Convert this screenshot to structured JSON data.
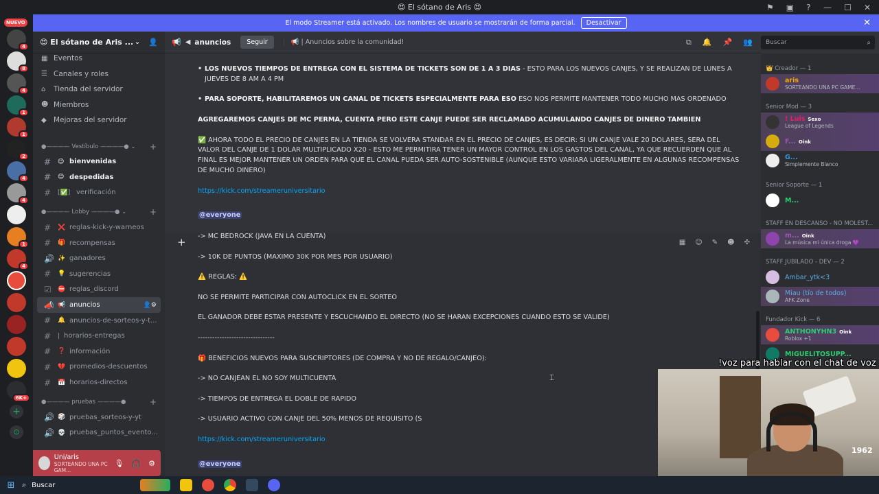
{
  "titlebar": {
    "title": "😍 El sótano de Aris 😍"
  },
  "banner": {
    "text": "El modo Streamer está activado. Los nombres de usuario se mostrarán de forma parcial.",
    "button": "Desactivar"
  },
  "rail": {
    "new_badge": "NUEVO",
    "pings": [
      "4",
      "8",
      "4",
      "1",
      "1",
      "2",
      "4",
      "4",
      "1",
      "4",
      "6K+"
    ]
  },
  "server": {
    "name": "😍 El sótano de Aris ..."
  },
  "menu": [
    "Eventos",
    "Canales y roles",
    "Tienda del servidor",
    "Miembros",
    "Mejoras del servidor"
  ],
  "categories": {
    "vestibulo": "Vestíbulo",
    "lobby": "Lobby",
    "pruebas": "pruebas"
  },
  "channels_vestibulo": [
    {
      "emoji": "😊",
      "name": "bienvenidas"
    },
    {
      "emoji": "😊",
      "name": "despedidas"
    },
    {
      "emoji": "[✅]",
      "name": "verificación"
    }
  ],
  "channels_lobby": [
    {
      "emoji": "❌",
      "name": "reglas-kick-y-warneos"
    },
    {
      "emoji": "🎁",
      "name": "recompensas"
    },
    {
      "emoji": "✨",
      "name": "ganadores"
    },
    {
      "emoji": "💡",
      "name": "sugerencias"
    },
    {
      "emoji": "⛔",
      "name": "reglas_discord"
    },
    {
      "emoji": "📢",
      "name": "anuncios"
    },
    {
      "emoji": "🔔",
      "name": "anuncios-de-sorteos-y-t..."
    },
    {
      "emoji": "",
      "name": "horarios-entregas"
    },
    {
      "emoji": "❓",
      "name": "información"
    },
    {
      "emoji": "💔",
      "name": "promedios-descuentos"
    },
    {
      "emoji": "📅",
      "name": "horarios-directos"
    }
  ],
  "channels_pruebas": [
    {
      "emoji": "🎲",
      "name": "pruebas_sorteos-y-yt"
    },
    {
      "emoji": "💀",
      "name": "pruebas_puntos_evento..."
    }
  ],
  "user": {
    "name": "Uni/aris",
    "status": "SORTEANDO UNA PC GAM..."
  },
  "header": {
    "channel": "anuncios",
    "follow": "Seguir",
    "topic": "📢 | Anuncios sobre la comunidad!",
    "search_placeholder": "Buscar"
  },
  "messages": {
    "top": [
      {
        "bold": "LOS NUEVOS TIEMPOS DE ENTREGA CON EL SISTEMA DE TICKETS SON DE 1 A 3 DIAS",
        "rest": " - ESTO PARA LOS NUEVOS CANJES, Y SE REALIZAN DE LUNES A JUEVES DE 8 AM A 4 PM"
      },
      {
        "bold": "PARA SOPORTE, HABILITAREMOS UN CANAL DE TICKETS ESPECIALMENTE PARA ESO",
        "rest": " ESO NOS PERMITE MANTENER TODO MUCHO MAS ORDENADO"
      }
    ],
    "perma": "AGREGAREMOS CANJES DE MC PERMA, CUENTA PERO ESTE CANJE PUEDE SER RECLAMADO ACUMULANDO CANJES DE DINERO TAMBIEN",
    "standard": "✅ AHORA TODO EL PRECIO DE CANJES EN LA TIENDA SE VOLVERA STANDAR EN EL PRECIO DE CANJES, ES DECIR: SI UN CANJE VALE 20 DOLARES, SERA DEL VALOR DEL CANJE DE 1 DOLAR MULTIPLICADO X20 - ESTO ME PERMITIRA TENER UN MAYOR CONTROL EN LOS GASTOS DEL CANAL, YA QUE RECUERDEN QUE AL FINAL ES MEJOR MANTENER UN ORDEN PARA QUE EL CANAL PUEDA SER AUTO-SOSTENIBLE (AUNQUE ESTO VARIARA LIGERALMENTE EN ALGUNAS RECOMPENSAS DE MUCHO DINERO)",
    "link": "https://kick.com/streameruniversitario",
    "mention": "@everyone",
    "second": [
      "-> MC BEDROCK (JAVA EN LA CUENTA)",
      "-> 10K DE PUNTOS (MAXIMO 30K POR MES POR USUARIO)",
      "⚠️ REGLAS: ⚠️",
      "NO SE PERMITE PARTICIPAR CON AUTOCLICK EN EL SORTEO",
      "EL GANADOR DEBE ESTAR PRESENTE Y ESCUCHANDO EL DIRECTO (NO SE HARAN EXCEPCIONES CUANDO ESTO SE VALIDE)",
      "--------------------------------",
      "🎁 BENEFICIOS NUEVOS PARA SUSCRIPTORES (DE COMPRA Y NO DE REGALO/CANJEO):",
      "-> NO CANJEAN EL NO SOY MULTICUENTA",
      "-> TIEMPOS DE ENTREGA EL DOBLE DE RAPIDO",
      "-> USUARIO ACTIVO CON CANJE DEL 50% MENOS DE REQUISITO (S"
    ]
  },
  "members": {
    "creador": {
      "cat": "👑 Creador — 1",
      "list": [
        {
          "name": "aris",
          "color": "#f2a900",
          "sub": "SORTEANDO UNA PC GAME..."
        }
      ]
    },
    "senior_mod": {
      "cat": "Senior Mod — 3",
      "list": [
        {
          "name": "! Luis",
          "color": "#e91e63",
          "tag": "Sexo",
          "sub": "League of Legends"
        },
        {
          "name": "F...",
          "color": "#9b59b6",
          "tag": "Oink",
          "sub": ""
        },
        {
          "name": "G...",
          "color": "#3498db",
          "tag": "",
          "sub": "Simplemente Blanco"
        }
      ]
    },
    "senior_soporte": {
      "cat": "Senior Soporte — 1",
      "list": [
        {
          "name": "M...",
          "color": "#2ecc71",
          "sub": ""
        }
      ]
    },
    "descanso": {
      "cat": "STAFF EN DESCANSO - NO MOLEST...",
      "list": [
        {
          "name": "m...",
          "color": "#9b59b6",
          "tag": "Oink",
          "sub": "La música mi única droga 💜"
        }
      ]
    },
    "jubilado": {
      "cat": "STAFF JUBILADO - DEV — 2",
      "list": [
        {
          "name": "Ambar_ytk<3",
          "color": "#5dade2",
          "sub": ""
        },
        {
          "name": "Miau (tío de todos)",
          "color": "#5dade2",
          "sub": "AFK Zone"
        }
      ]
    },
    "fundador": {
      "cat": "Fundador Kick — 6",
      "list": [
        {
          "name": "ANTHONYHN3",
          "color": "#2ecc71",
          "tag": "Oink",
          "sub": "Roblox +1"
        },
        {
          "name": "MIGUELITOSUPP...",
          "color": "#2ecc71",
          "tag": "",
          "sub": ""
        }
      ]
    }
  },
  "overlay": {
    "text": "!voz para hablar con el chat de voz",
    "cam_badge": "1962"
  },
  "taskbar": {
    "search": "Buscar"
  }
}
